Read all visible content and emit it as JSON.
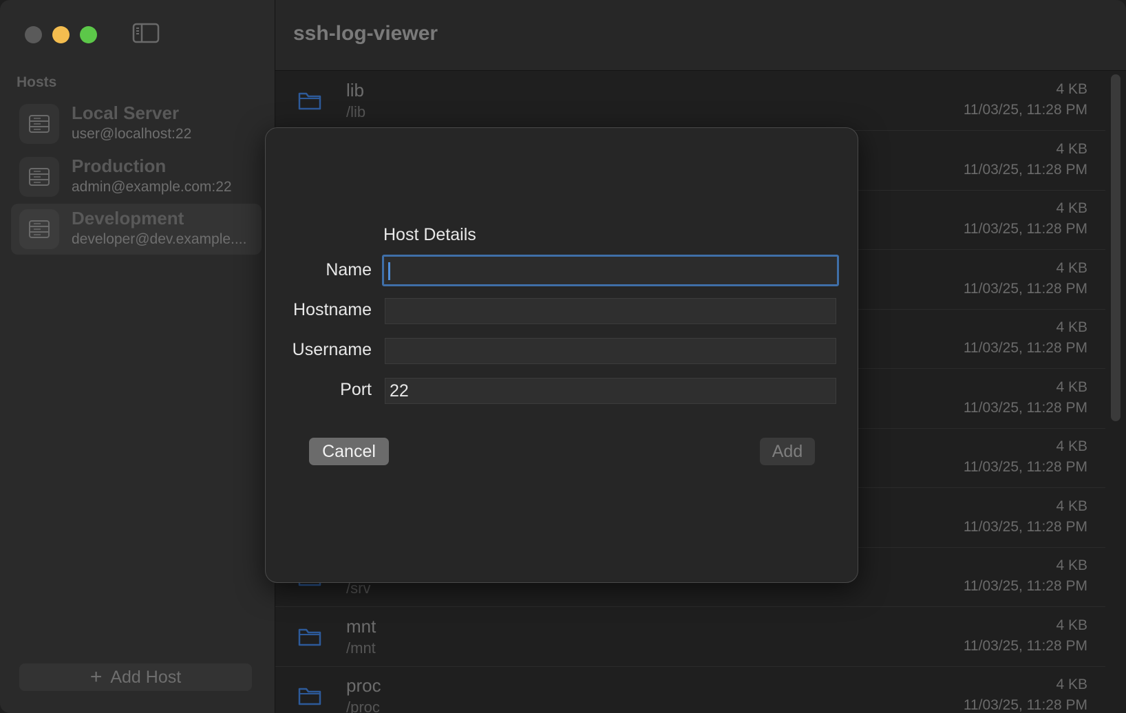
{
  "window": {
    "title": "ssh-log-viewer"
  },
  "sidebar": {
    "heading": "Hosts",
    "hosts": [
      {
        "name": "Local Server",
        "address": "user@localhost:22",
        "icon": "server-icon"
      },
      {
        "name": "Production",
        "address": "admin@example.com:22",
        "icon": "server-icon"
      },
      {
        "name": "Development",
        "address": "developer@dev.example....",
        "icon": "server-icon",
        "selected": true
      }
    ],
    "add_host_label": "Add Host",
    "add_icon": "+"
  },
  "files": [
    {
      "name": "lib",
      "path": "/lib",
      "size": "4 KB",
      "date": "11/03/25, 11:28 PM"
    },
    {
      "name": "",
      "path": "",
      "size": "4 KB",
      "date": "11/03/25, 11:28 PM"
    },
    {
      "name": "",
      "path": "",
      "size": "4 KB",
      "date": "11/03/25, 11:28 PM"
    },
    {
      "name": "",
      "path": "",
      "size": "4 KB",
      "date": "11/03/25, 11:28 PM"
    },
    {
      "name": "",
      "path": "",
      "size": "4 KB",
      "date": "11/03/25, 11:28 PM"
    },
    {
      "name": "",
      "path": "",
      "size": "4 KB",
      "date": "11/03/25, 11:28 PM"
    },
    {
      "name": "",
      "path": "",
      "size": "4 KB",
      "date": "11/03/25, 11:28 PM"
    },
    {
      "name": "",
      "path": "",
      "size": "4 KB",
      "date": "11/03/25, 11:28 PM"
    },
    {
      "name": "",
      "path": "/srv",
      "size": "4 KB",
      "date": "11/03/25, 11:28 PM"
    },
    {
      "name": "mnt",
      "path": "/mnt",
      "size": "4 KB",
      "date": "11/03/25, 11:28 PM"
    },
    {
      "name": "proc",
      "path": "/proc",
      "size": "4 KB",
      "date": "11/03/25, 11:28 PM"
    }
  ],
  "dialog": {
    "section_title": "Host Details",
    "fields": {
      "name": {
        "label": "Name",
        "value": ""
      },
      "hostname": {
        "label": "Hostname",
        "value": ""
      },
      "username": {
        "label": "Username",
        "value": ""
      },
      "port": {
        "label": "Port",
        "value": "22"
      }
    },
    "cancel_label": "Cancel",
    "add_label": "Add"
  },
  "colors": {
    "accent": "#3f6fa8",
    "traffic_close": "#5a5a5a",
    "traffic_minimize": "#f4bd4f",
    "traffic_maximize": "#5cc749",
    "folder": "#2d5a9a"
  }
}
